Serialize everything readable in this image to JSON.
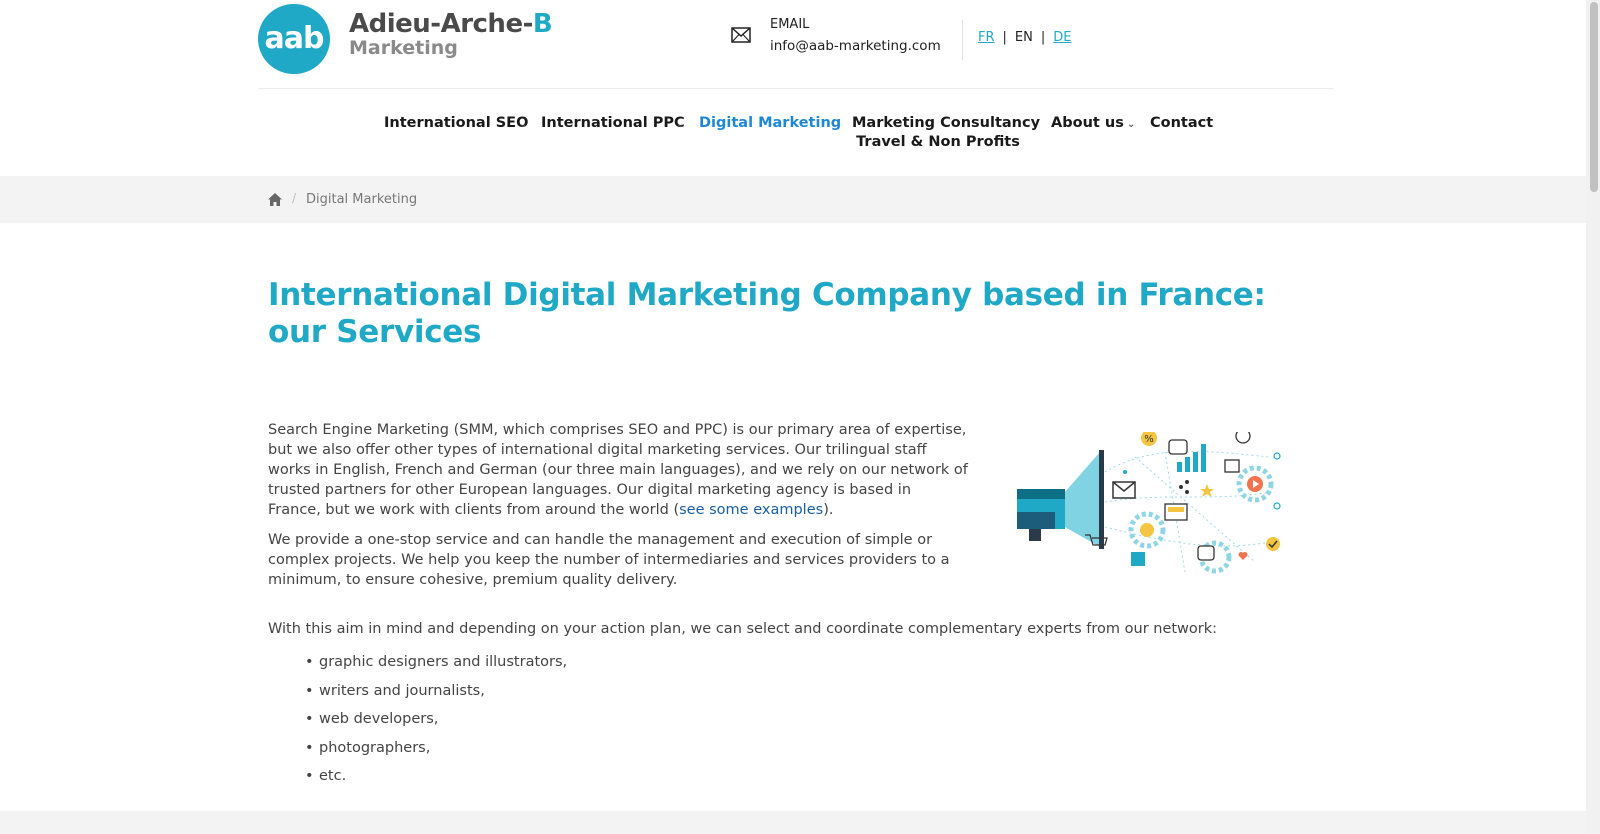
{
  "brand": {
    "logo_text": "aab",
    "name_main": "Adieu-Arche-",
    "name_accent": "B",
    "name_sub": "Marketing",
    "accent_color": "#1fa9c6"
  },
  "contact": {
    "icon": "mail-icon",
    "label": "EMAIL",
    "email": "info@aab-marketing.com"
  },
  "languages": [
    {
      "code": "FR",
      "active": false
    },
    {
      "code": "EN",
      "active": true
    },
    {
      "code": "DE",
      "active": false
    }
  ],
  "language_separator": "|",
  "nav": {
    "items": [
      {
        "label": "International SEO",
        "has_dropdown": true
      },
      {
        "label": "International PPC",
        "has_dropdown": true
      },
      {
        "label": "Digital Marketing",
        "active": true
      },
      {
        "label_line1": "Marketing Consultancy",
        "label_line2": "Travel & Non Profits"
      },
      {
        "label": "About us",
        "has_dropdown": true
      },
      {
        "label": "Contact"
      }
    ],
    "active_color": "#1e88d6"
  },
  "breadcrumb": {
    "home_icon": "home-icon",
    "separator": "/",
    "current": "Digital Marketing"
  },
  "main": {
    "title": "International Digital Marketing Company based in France: our Services",
    "p1_text": "Search Engine Marketing (SMM, which comprises SEO and PPC) is our primary area of expertise, but we also offer other types of international digital marketing services. Our trilingual staff works in English, French and German (our three main languages), and we rely on our network of trusted partners for other European languages. Our digital marketing agency is based in France, but we work with clients from around the world (",
    "p1_link": "see some examples",
    "p1_end": ").",
    "p2": "We provide a one-stop service and can handle the management and execution of simple or complex projects. We help you keep the number of intermediaries and services providers to a minimum, to ensure cohesive, premium quality delivery.",
    "p3": "With this aim in mind and depending on your action plan, we can select and coordinate complementary experts from our network:",
    "experts": [
      "graphic designers and illustrators,",
      "writers and journalists,",
      "web developers,",
      "photographers,",
      "etc."
    ],
    "illustration": "digital-marketing-megaphone-illustration"
  }
}
